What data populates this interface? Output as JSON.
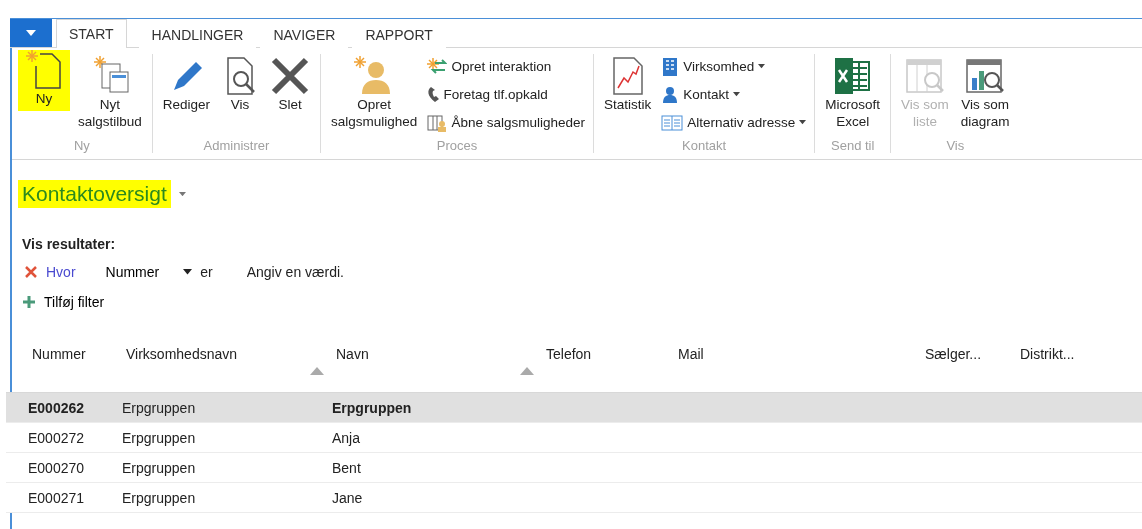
{
  "tabs": [
    {
      "label": "START",
      "selected": true
    },
    {
      "label": "HANDLINGER",
      "selected": false
    },
    {
      "label": "NAVIGER",
      "selected": false
    },
    {
      "label": "RAPPORT",
      "selected": false
    }
  ],
  "ribbon": {
    "groups": [
      {
        "label": "Ny",
        "items": [
          {
            "kind": "large",
            "label": "Ny",
            "highlighted": true,
            "disabled": false
          },
          {
            "kind": "large",
            "label": "Nyt\nsalgstilbud",
            "highlighted": false,
            "disabled": false
          }
        ]
      },
      {
        "label": "Administrer",
        "items": [
          {
            "kind": "large",
            "label": "Rediger",
            "highlighted": false,
            "disabled": false
          },
          {
            "kind": "large",
            "label": "Vis",
            "highlighted": false,
            "disabled": false
          },
          {
            "kind": "large",
            "label": "Slet",
            "highlighted": false,
            "disabled": false
          }
        ]
      },
      {
        "label": "Proces",
        "items": [
          {
            "kind": "large",
            "label": "Opret\nsalgsmulighed",
            "highlighted": false,
            "disabled": false
          },
          {
            "kind": "small",
            "label": "Opret interaktion",
            "dropdown": false
          },
          {
            "kind": "small",
            "label": "Foretag tlf.opkald",
            "dropdown": false
          },
          {
            "kind": "small",
            "label": "Åbne salgsmuligheder",
            "dropdown": false
          }
        ]
      },
      {
        "label": "Kontakt",
        "items": [
          {
            "kind": "large",
            "label": "Statistik",
            "highlighted": false,
            "disabled": false
          },
          {
            "kind": "small",
            "label": "Virksomhed",
            "dropdown": true
          },
          {
            "kind": "small",
            "label": "Kontakt",
            "dropdown": true
          },
          {
            "kind": "small",
            "label": "Alternativ adresse",
            "dropdown": true
          }
        ]
      },
      {
        "label": "Send til",
        "items": [
          {
            "kind": "large",
            "label": "Microsoft\nExcel",
            "highlighted": false,
            "disabled": false
          }
        ]
      },
      {
        "label": "Vis",
        "items": [
          {
            "kind": "large",
            "label": "Vis som\nliste",
            "highlighted": false,
            "disabled": true
          },
          {
            "kind": "large",
            "label": "Vis som\ndiagram",
            "highlighted": false,
            "disabled": false
          }
        ]
      }
    ]
  },
  "page_title": {
    "text": "Kontaktoversigt",
    "highlighted": true
  },
  "filter": {
    "heading": "Vis resultater:",
    "link": "Hvor",
    "field": "Nummer",
    "operator": "er",
    "placeholder": "Angiv en værdi.",
    "add_filter": "Tilføj filter"
  },
  "table": {
    "columns": [
      {
        "label": "Nummer",
        "sorted": false
      },
      {
        "label": "Virksomhedsnavn",
        "sorted": true
      },
      {
        "label": "Navn",
        "sorted": true
      },
      {
        "label": "Telefon",
        "sorted": false
      },
      {
        "label": "Mail",
        "sorted": false
      },
      {
        "label": "Sælger...",
        "sorted": false
      },
      {
        "label": "Distrikt...",
        "sorted": false
      }
    ],
    "rows": [
      {
        "selected": true,
        "cells": [
          {
            "text": "E000262",
            "bold": true
          },
          {
            "text": "Erpgruppen",
            "bold": false
          },
          {
            "text": "Erpgruppen",
            "bold": true
          }
        ]
      },
      {
        "selected": false,
        "cells": [
          {
            "text": "E000272",
            "bold": false
          },
          {
            "text": "Erpgruppen",
            "bold": false
          },
          {
            "text": "Anja",
            "bold": false
          }
        ]
      },
      {
        "selected": false,
        "cells": [
          {
            "text": "E000270",
            "bold": false
          },
          {
            "text": "Erpgruppen",
            "bold": false
          },
          {
            "text": "Bent",
            "bold": false
          }
        ]
      },
      {
        "selected": false,
        "cells": [
          {
            "text": "E000271",
            "bold": false
          },
          {
            "text": "Erpgruppen",
            "bold": false
          },
          {
            "text": "Jane",
            "bold": false
          }
        ]
      }
    ]
  }
}
